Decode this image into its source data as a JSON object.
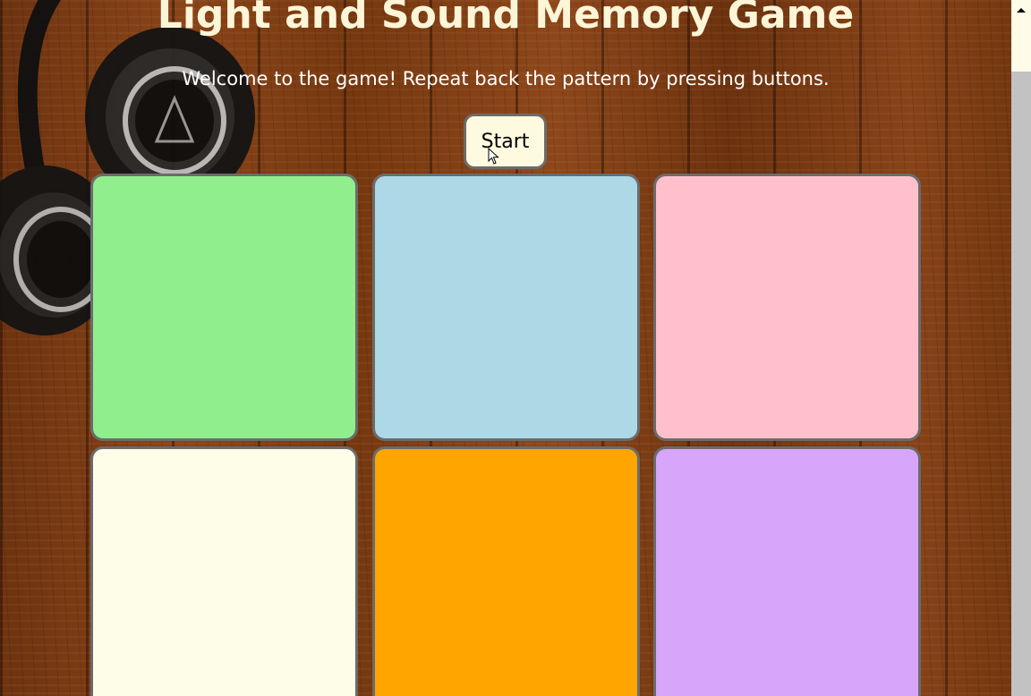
{
  "page": {
    "title": "Light and Sound Memory Game",
    "subtitle": "Welcome to the game! Repeat back the pattern by pressing buttons."
  },
  "controls": {
    "start_label": "Start"
  },
  "pads": [
    {
      "name": "pad-1",
      "color": "#90ee8c"
    },
    {
      "name": "pad-2",
      "color": "#add8e6"
    },
    {
      "name": "pad-3",
      "color": "#ffc0cb"
    },
    {
      "name": "pad-4",
      "color": "#fdfde8"
    },
    {
      "name": "pad-5",
      "color": "#ffa500"
    },
    {
      "name": "pad-6",
      "color": "#d7a5fa"
    }
  ],
  "icons": {
    "background_decoration": "headphones-icon",
    "cursor": "mouse-pointer-icon",
    "scroll_up": "scroll-up-arrow-icon"
  }
}
